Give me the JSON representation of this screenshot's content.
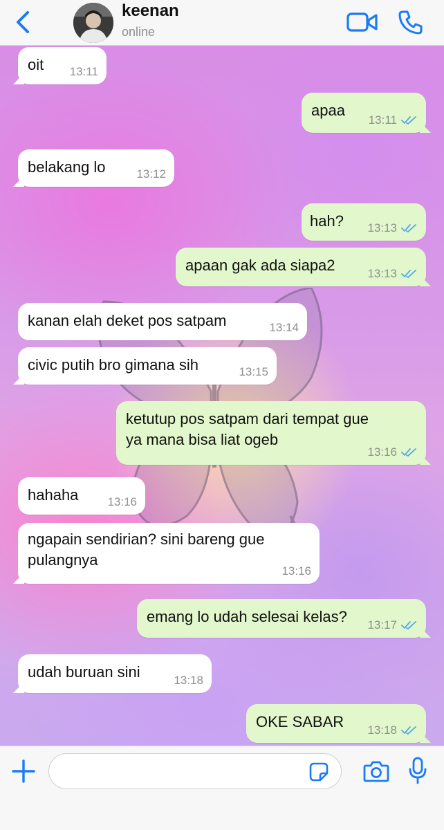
{
  "header": {
    "contact_name": "keenan",
    "status": "online"
  },
  "colors": {
    "accent": "#1a7cf5",
    "incoming_bubble": "#ffffff",
    "outgoing_bubble": "#e2f7cc",
    "read_ticks": "#4fa8e8"
  },
  "icons": {
    "back": "chevron-left-icon",
    "video": "video-camera-icon",
    "call": "phone-icon",
    "plus": "plus-icon",
    "sticker": "sticker-icon",
    "camera": "camera-icon",
    "mic": "microphone-icon",
    "read": "double-check-icon"
  },
  "messages": [
    {
      "direction": "in",
      "text": "oit",
      "time": "13:11"
    },
    {
      "direction": "out",
      "text": "apaa",
      "time": "13:11",
      "read": true
    },
    {
      "direction": "in",
      "text": "belakang lo",
      "time": "13:12"
    },
    {
      "direction": "out",
      "text": "hah?",
      "time": "13:13",
      "read": true
    },
    {
      "direction": "out",
      "text": "apaan gak ada siapa2",
      "time": "13:13",
      "read": true
    },
    {
      "direction": "in",
      "text": "kanan elah deket pos satpam",
      "time": "13:14"
    },
    {
      "direction": "in",
      "text": "civic putih bro gimana sih",
      "time": "13:15"
    },
    {
      "direction": "out",
      "lines": [
        "ketutup pos satpam dari tempat gue",
        "ya mana bisa liat ogeb"
      ],
      "time": "13:16",
      "read": true
    },
    {
      "direction": "in",
      "text": "hahaha",
      "time": "13:16"
    },
    {
      "direction": "in",
      "lines": [
        "ngapain sendirian? sini bareng gue",
        "pulangnya"
      ],
      "time": "13:16"
    },
    {
      "direction": "out",
      "text": "emang lo udah selesai kelas?",
      "time": "13:17",
      "read": true
    },
    {
      "direction": "in",
      "text": "udah buruan sini",
      "time": "13:18"
    },
    {
      "direction": "out",
      "text": "OKE SABAR",
      "time": "13:18",
      "read": true
    }
  ],
  "composer": {
    "value": "",
    "placeholder": ""
  }
}
